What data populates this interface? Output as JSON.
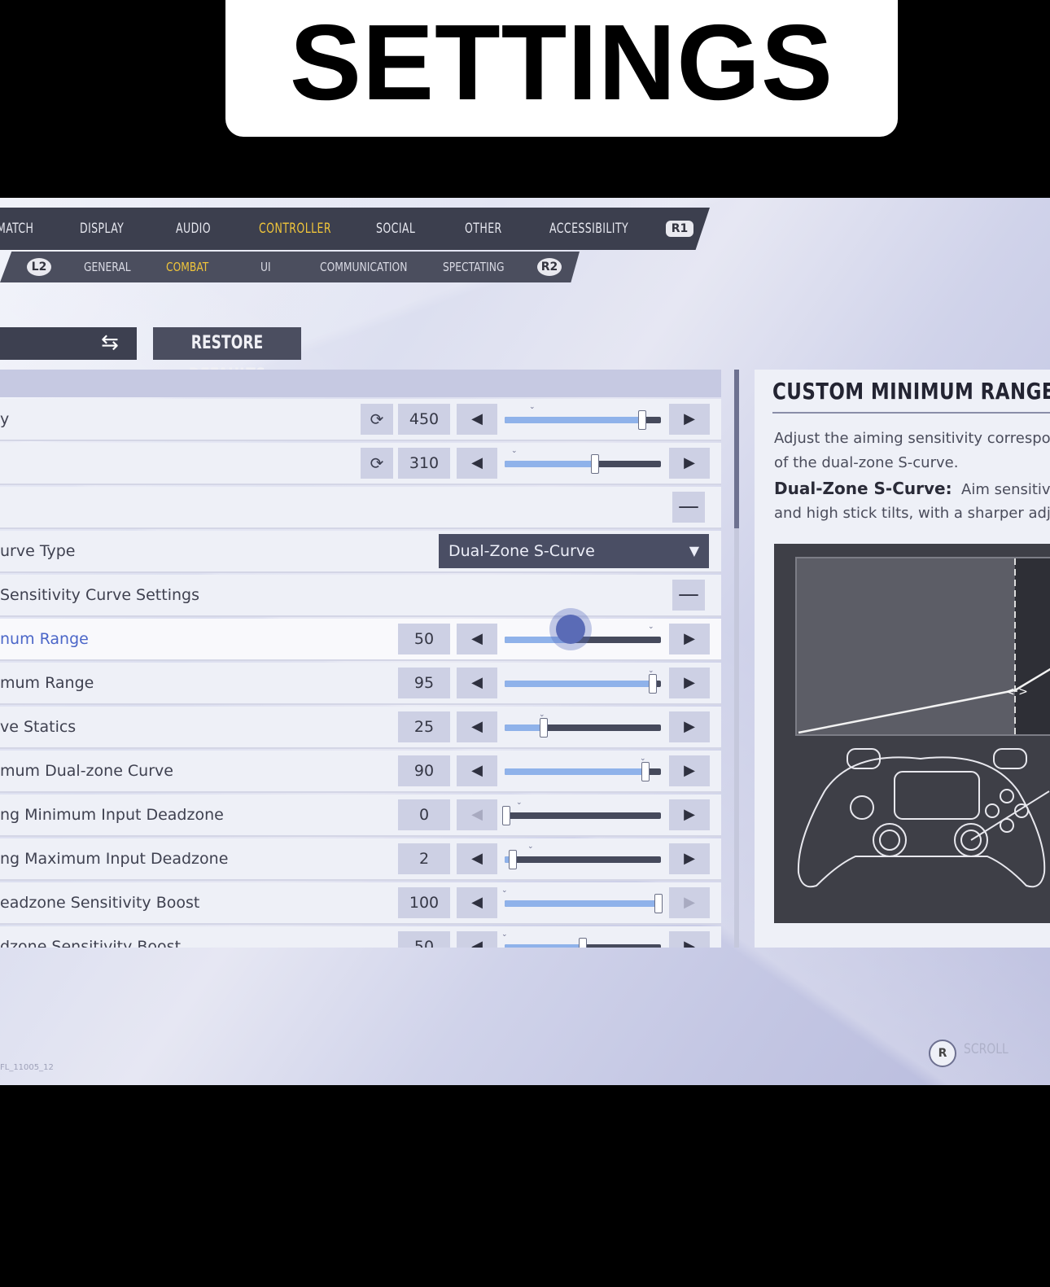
{
  "banner": {
    "title": "SETTINGS"
  },
  "nav": {
    "tabs": [
      {
        "label": "MATCH"
      },
      {
        "label": "DISPLAY"
      },
      {
        "label": "AUDIO"
      },
      {
        "label": "CONTROLLER"
      },
      {
        "label": "SOCIAL"
      },
      {
        "label": "OTHER"
      },
      {
        "label": "ACCESSIBILITY"
      }
    ],
    "active_tab": "CONTROLLER",
    "next_button": "R1",
    "prev_sub_button": "L2",
    "next_sub_button": "R2",
    "subtabs": [
      {
        "label": "GENERAL"
      },
      {
        "label": "COMBAT"
      },
      {
        "label": "UI"
      },
      {
        "label": "COMMUNICATION"
      },
      {
        "label": "SPECTATING"
      }
    ],
    "active_subtab": "COMBAT",
    "accent_color": "#f0c53a"
  },
  "toolbar": {
    "restore_label": "RESTORE DEFAULTS"
  },
  "rows": [
    {
      "label": "y",
      "value": "450",
      "fraction": 0.88,
      "disabled_left": false,
      "disabled_right": false
    },
    {
      "label": "",
      "value": "310",
      "fraction": 0.58,
      "disabled_left": false,
      "disabled_right": false
    },
    {
      "label": ""
    },
    {
      "label": "urve Type",
      "dropdown": "Dual-Zone S-Curve"
    },
    {
      "label": "Sensitivity Curve Settings"
    },
    {
      "label": "num Range",
      "value": "50",
      "fraction": 0.42
    },
    {
      "label": "mum Range",
      "value": "95",
      "fraction": 0.95
    },
    {
      "label": "ve Statics",
      "value": "25",
      "fraction": 0.25
    },
    {
      "label": "mum Dual-zone Curve",
      "value": "90",
      "fraction": 0.9
    },
    {
      "label": "ng Minimum Input Deadzone",
      "value": "0",
      "fraction": 0.0
    },
    {
      "label": "ng Maximum Input Deadzone",
      "value": "2",
      "fraction": 0.05
    },
    {
      "label": "eadzone Sensitivity Boost",
      "value": "100",
      "fraction": 1.0
    },
    {
      "label": "dzone Sensitivity Boost",
      "value": "50",
      "fraction": 0.5
    }
  ],
  "info": {
    "title": "CUSTOM MINIMUM RANGE",
    "line1": "Adjust the aiming sensitivity correspo",
    "line2": "of the dual-zone S-curve.",
    "term": "Dual-Zone S-Curve:",
    "term_desc": "Aim sensitivit",
    "line4": "and high stick tilts, with a sharper adj"
  },
  "footer": {
    "button": "R",
    "label": "SCROLL",
    "version": "FL_11005_12"
  },
  "icons": {
    "reset": "reset-icon",
    "swap": "swap-icon",
    "left": "arrow-left-icon",
    "right": "arrow-right-icon",
    "minus": "collapse-icon",
    "caret": "dropdown-caret-icon"
  }
}
